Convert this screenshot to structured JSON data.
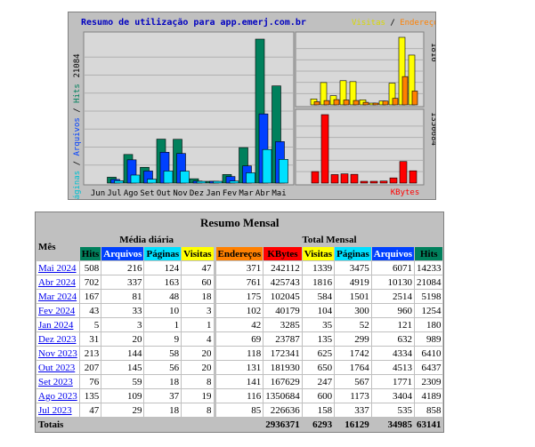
{
  "chart": {
    "title": "Resumo de utilização para app.emerj.com.br",
    "legend_visits": "Visitas",
    "legend_sep": " / ",
    "legend_addresses": "Endereços",
    "ymax_label": "21084",
    "yaxis_pages": "Páginas",
    "yaxis_files": "Arquivos",
    "yaxis_hits": "Hits",
    "yaxis_sep": " / ",
    "right_top_max": "1816",
    "right_bottom_max": "1350684",
    "kbytes_label": "KBytes",
    "months": [
      "Jun",
      "Jul",
      "Ago",
      "Set",
      "Out",
      "Nov",
      "Dez",
      "Jan",
      "Fev",
      "Mar",
      "Abr",
      "Mai"
    ],
    "colors": {
      "hits": "#00805c",
      "files": "#0040ff",
      "pages": "#00e0ff",
      "visits": "#ffff00",
      "addresses": "#ff8000",
      "kbytes": "#ff0000",
      "bg": "#c0c0c0",
      "plot": "#d8d8d8"
    }
  },
  "chart_data": {
    "type": "bar",
    "categories": [
      "Jun",
      "Jul",
      "Ago",
      "Set",
      "Out",
      "Nov",
      "Dez",
      "Jan",
      "Fev",
      "Mar",
      "Abr",
      "Mai"
    ],
    "ymax": 21084,
    "series": [
      {
        "name": "Hits",
        "values": [
          0,
          858,
          4189,
          2309,
          6437,
          6410,
          632,
          180,
          1254,
          5198,
          21084,
          14233
        ]
      },
      {
        "name": "Arquivos",
        "values": [
          0,
          535,
          3404,
          1771,
          4513,
          4334,
          299,
          121,
          960,
          2514,
          10130,
          6071
        ]
      },
      {
        "name": "Páginas",
        "values": [
          0,
          337,
          1173,
          567,
          1764,
          1742,
          135,
          52,
          300,
          1501,
          4919,
          3475
        ]
      }
    ],
    "visits": {
      "ymax": 1816,
      "values": [
        0,
        158,
        600,
        247,
        650,
        625,
        135,
        35,
        104,
        584,
        1816,
        1339
      ]
    },
    "addresses": {
      "values": [
        0,
        85,
        116,
        141,
        131,
        118,
        69,
        42,
        102,
        175,
        761,
        371
      ]
    },
    "kbytes": {
      "ymax": 1350684,
      "values": [
        0,
        226636,
        1350684,
        167629,
        181930,
        172341,
        23787,
        3285,
        40179,
        102045,
        425743,
        242112
      ]
    }
  },
  "table": {
    "title": "Resumo Mensal",
    "col_month": "Mês",
    "group_daily": "Média diária",
    "group_total": "Total Mensal",
    "headers": {
      "hits": "Hits",
      "files": "Arquivos",
      "pages": "Páginas",
      "visits": "Visitas",
      "addresses": "Endereços",
      "kbytes": "KBytes"
    },
    "rows": [
      {
        "month": "Mai 2024",
        "d_hits": "508",
        "d_files": "216",
        "d_pages": "124",
        "d_visits": "47",
        "addr": "371",
        "kb": "242112",
        "visits": "1339",
        "pages": "3475",
        "files": "6071",
        "hits": "14233"
      },
      {
        "month": "Abr 2024",
        "d_hits": "702",
        "d_files": "337",
        "d_pages": "163",
        "d_visits": "60",
        "addr": "761",
        "kb": "425743",
        "visits": "1816",
        "pages": "4919",
        "files": "10130",
        "hits": "21084"
      },
      {
        "month": "Mar 2024",
        "d_hits": "167",
        "d_files": "81",
        "d_pages": "48",
        "d_visits": "18",
        "addr": "175",
        "kb": "102045",
        "visits": "584",
        "pages": "1501",
        "files": "2514",
        "hits": "5198"
      },
      {
        "month": "Fev 2024",
        "d_hits": "43",
        "d_files": "33",
        "d_pages": "10",
        "d_visits": "3",
        "addr": "102",
        "kb": "40179",
        "visits": "104",
        "pages": "300",
        "files": "960",
        "hits": "1254"
      },
      {
        "month": "Jan 2024",
        "d_hits": "5",
        "d_files": "3",
        "d_pages": "1",
        "d_visits": "1",
        "addr": "42",
        "kb": "3285",
        "visits": "35",
        "pages": "52",
        "files": "121",
        "hits": "180"
      },
      {
        "month": "Dez 2023",
        "d_hits": "31",
        "d_files": "20",
        "d_pages": "9",
        "d_visits": "4",
        "addr": "69",
        "kb": "23787",
        "visits": "135",
        "pages": "299",
        "files": "632",
        "hits": "989"
      },
      {
        "month": "Nov 2023",
        "d_hits": "213",
        "d_files": "144",
        "d_pages": "58",
        "d_visits": "20",
        "addr": "118",
        "kb": "172341",
        "visits": "625",
        "pages": "1742",
        "files": "4334",
        "hits": "6410"
      },
      {
        "month": "Out 2023",
        "d_hits": "207",
        "d_files": "145",
        "d_pages": "56",
        "d_visits": "20",
        "addr": "131",
        "kb": "181930",
        "visits": "650",
        "pages": "1764",
        "files": "4513",
        "hits": "6437"
      },
      {
        "month": "Set 2023",
        "d_hits": "76",
        "d_files": "59",
        "d_pages": "18",
        "d_visits": "8",
        "addr": "141",
        "kb": "167629",
        "visits": "247",
        "pages": "567",
        "files": "1771",
        "hits": "2309"
      },
      {
        "month": "Ago 2023",
        "d_hits": "135",
        "d_files": "109",
        "d_pages": "37",
        "d_visits": "19",
        "addr": "116",
        "kb": "1350684",
        "visits": "600",
        "pages": "1173",
        "files": "3404",
        "hits": "4189"
      },
      {
        "month": "Jul 2023",
        "d_hits": "47",
        "d_files": "29",
        "d_pages": "18",
        "d_visits": "8",
        "addr": "85",
        "kb": "226636",
        "visits": "158",
        "pages": "337",
        "files": "535",
        "hits": "858"
      }
    ],
    "totals": {
      "label": "Totais",
      "kb": "2936371",
      "visits": "6293",
      "pages": "16129",
      "files": "34985",
      "hits": "63141"
    }
  }
}
